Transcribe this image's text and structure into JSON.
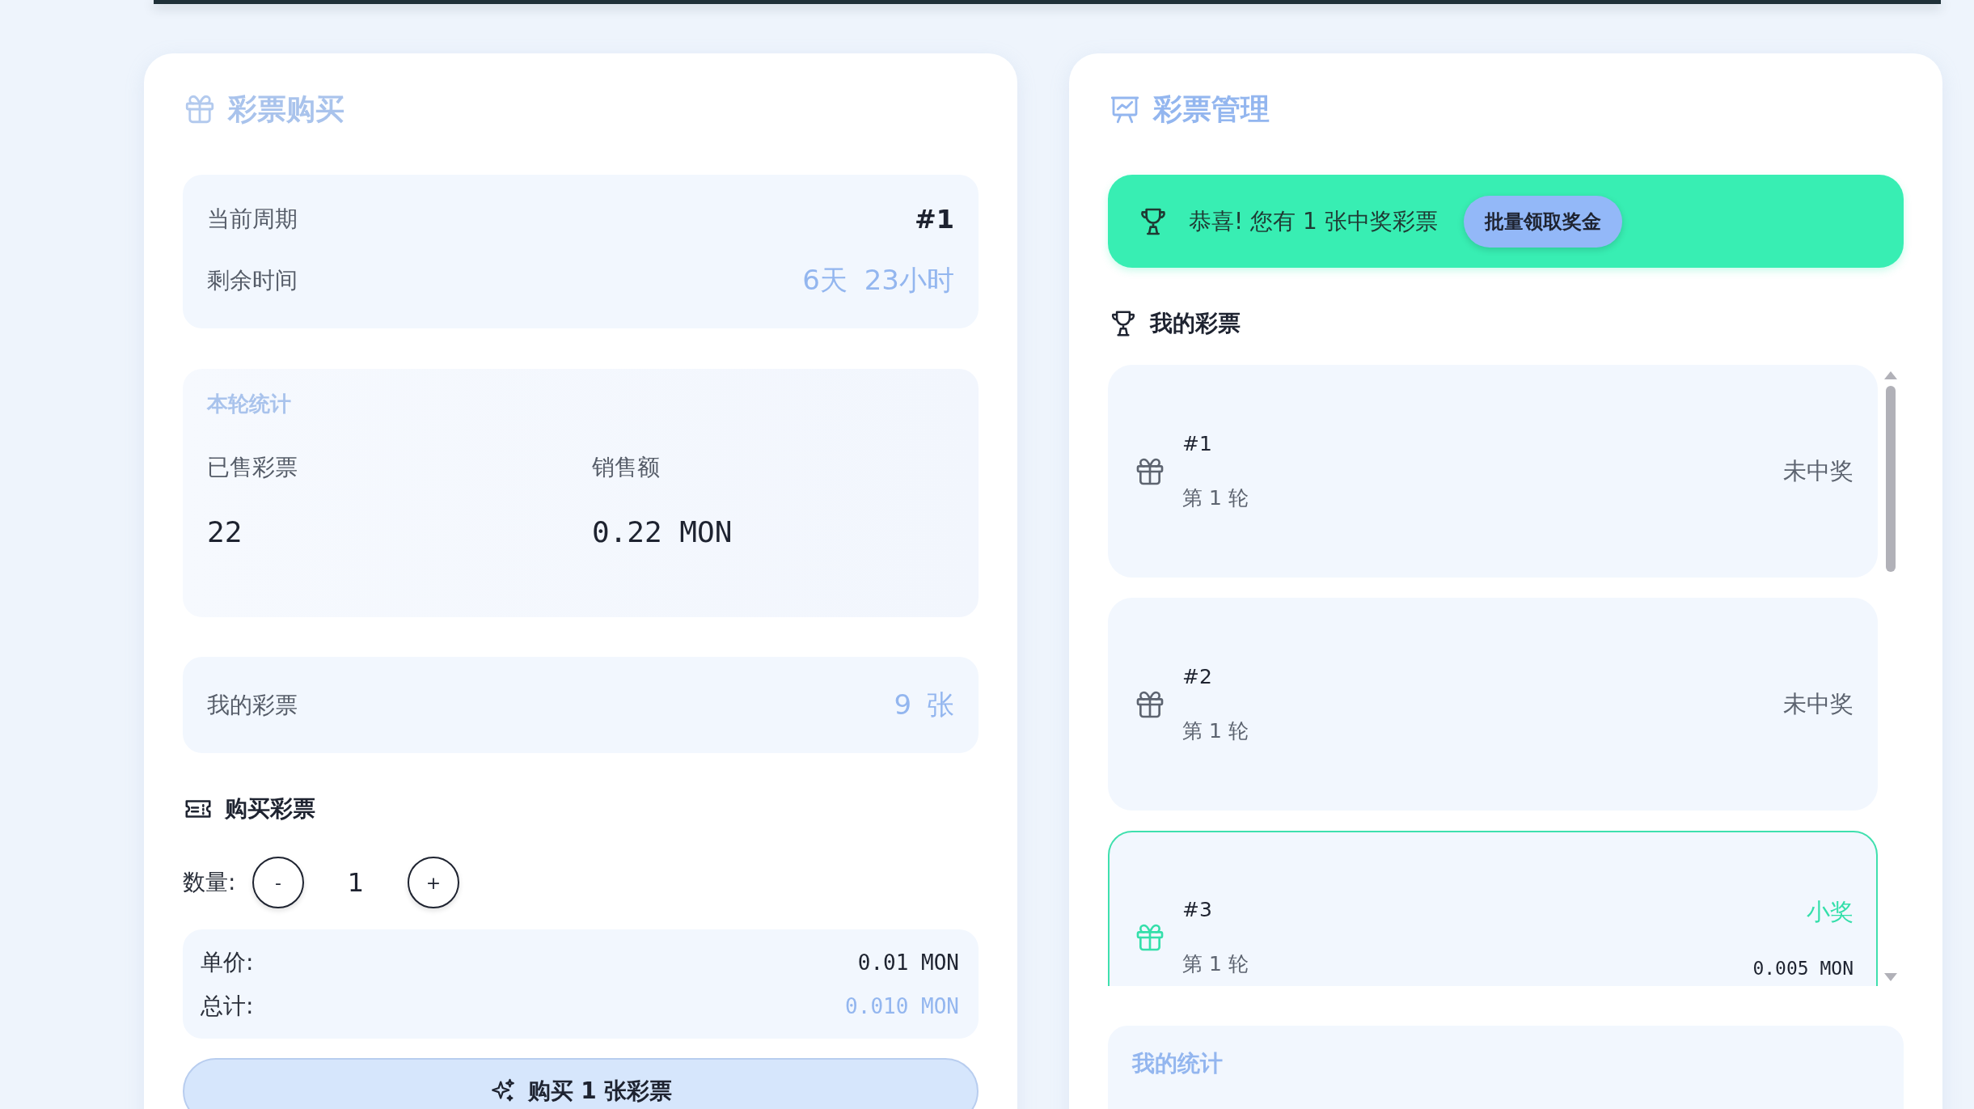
{
  "purchase": {
    "title": "彩票购买",
    "period": {
      "label": "当前周期",
      "value": "#1"
    },
    "remaining": {
      "label": "剩余时间",
      "value": "6天 23小时"
    },
    "round_stats": {
      "title": "本轮统计",
      "items": [
        {
          "label": "已售彩票",
          "value": "22"
        },
        {
          "label": "销售额",
          "value": "0.22 MON"
        }
      ]
    },
    "my_tickets": {
      "label": "我的彩票",
      "value": "9 张"
    },
    "buy": {
      "title": "购买彩票",
      "quantity_label": "数量:",
      "decrement": "-",
      "quantity": "1",
      "increment": "+",
      "unit_price_label": "单价:",
      "unit_price": "0.01 MON",
      "total_label": "总计:",
      "total": "0.010 MON",
      "button": "购买 1 张彩票"
    }
  },
  "management": {
    "title": "彩票管理",
    "banner": {
      "message": "恭喜! 您有 1 张中奖彩票",
      "button": "批量领取奖金"
    },
    "tickets_title": "我的彩票",
    "tickets": [
      {
        "number": "#1",
        "round": "第 1 轮",
        "status": "未中奖",
        "won": false
      },
      {
        "number": "#2",
        "round": "第 1 轮",
        "status": "未中奖",
        "won": false
      },
      {
        "number": "#3",
        "round": "第 1 轮",
        "status": "小奖",
        "prize": "0.005 MON",
        "won": true
      }
    ],
    "stats_title": "我的统计"
  }
}
